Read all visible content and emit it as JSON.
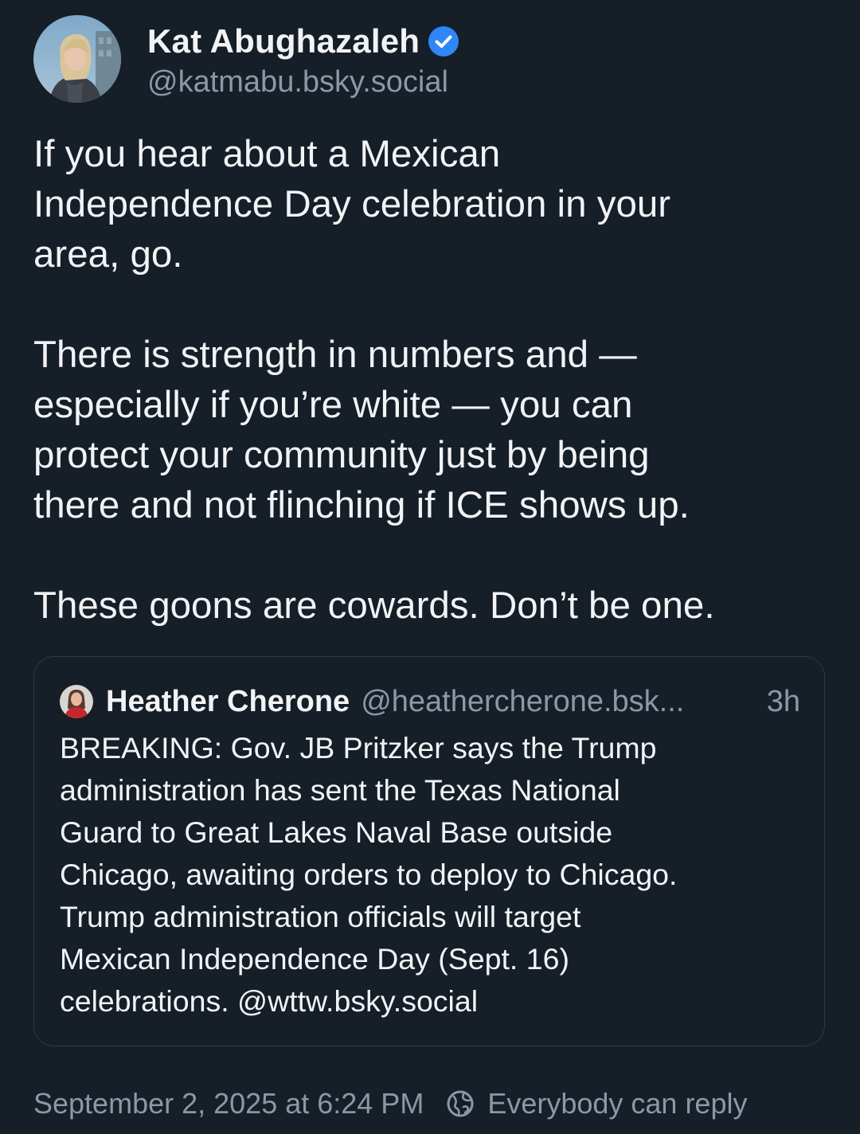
{
  "post": {
    "author": {
      "display_name": "Kat Abughazaleh",
      "handle": "@katmabu.bsky.social",
      "verified": true,
      "avatar_icon": "avatar-photo"
    },
    "text": {
      "paragraph_1": "If you hear about a Mexican\nIndependence Day celebration in your\narea, go.",
      "paragraph_2": "There is strength in numbers and —\nespecially if you’re white — you can\nprotect your community just by being\nthere and not flinching if ICE shows up.",
      "paragraph_3": "These goons are cowards. Don’t be one."
    },
    "quote": {
      "display_name": "Heather Cherone",
      "handle": "@heathercherone.bsk...",
      "time": "3h",
      "avatar_icon": "avatar-photo",
      "text": "BREAKING: Gov. JB Pritzker says the Trump\nadministration has sent the Texas National\nGuard to Great Lakes Naval Base outside\nChicago, awaiting orders to deploy to Chicago.\nTrump administration officials will target\nMexican Independence Day (Sept. 16)\ncelebrations. @wttw.bsky.social"
    },
    "footer": {
      "timestamp": "September 2, 2025 at 6:24 PM",
      "reply_setting": "Everybody can reply",
      "reply_icon": "globe-icon"
    }
  },
  "colors": {
    "background": "#161e27",
    "text_primary": "#f1f3f5",
    "text_secondary": "#8b98a6",
    "verified_badge": "#2f86f6",
    "card_border": "#2e3a47"
  }
}
